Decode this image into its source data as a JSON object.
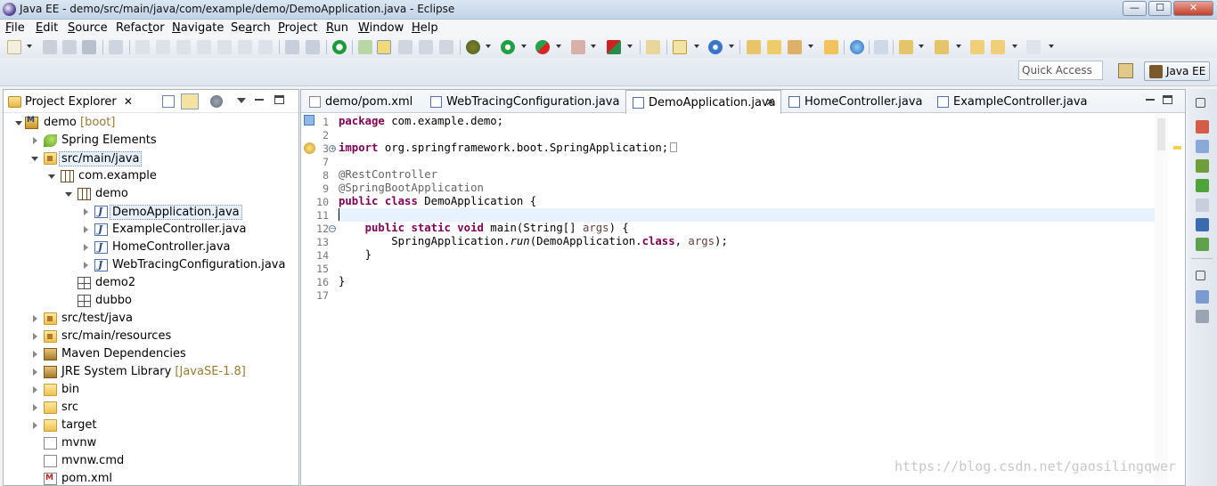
{
  "window": {
    "title": "Java EE - demo/src/main/java/com/example/demo/DemoApplication.java - Eclipse",
    "minimize": "—",
    "maximize": "☐",
    "close": "✕"
  },
  "menu": [
    {
      "u": "F",
      "rest": "ile"
    },
    {
      "u": "E",
      "rest": "dit"
    },
    {
      "u": "S",
      "rest": "ource"
    },
    {
      "u": "",
      "pre": "Refac",
      "uu": "t",
      "rest": "or"
    },
    {
      "u": "N",
      "rest": "avigate"
    },
    {
      "u": "",
      "pre": "Se",
      "uu": "a",
      "rest": "rch"
    },
    {
      "u": "P",
      "rest": "roject"
    },
    {
      "u": "R",
      "rest": "un"
    },
    {
      "u": "W",
      "rest": "indow"
    },
    {
      "u": "H",
      "rest": "elp"
    }
  ],
  "quick_access": {
    "placeholder": "Quick Access"
  },
  "perspective": {
    "label": "Java EE"
  },
  "explorer": {
    "title": "Project Explorer",
    "close": "✕",
    "tree": [
      {
        "label": "demo",
        "decor": "[boot]"
      },
      {
        "label": "Spring Elements"
      },
      {
        "label": "src/main/java"
      },
      {
        "label": "com.example"
      },
      {
        "label": "demo"
      },
      {
        "label": "DemoApplication.java"
      },
      {
        "label": "ExampleController.java"
      },
      {
        "label": "HomeController.java"
      },
      {
        "label": "WebTracingConfiguration.java"
      },
      {
        "label": "demo2"
      },
      {
        "label": "dubbo"
      },
      {
        "label": "src/test/java"
      },
      {
        "label": "src/main/resources"
      },
      {
        "label": "Maven Dependencies"
      },
      {
        "label": "JRE System Library",
        "decor": "[JavaSE-1.8]"
      },
      {
        "label": "bin"
      },
      {
        "label": "src"
      },
      {
        "label": "target"
      },
      {
        "label": "mvnw"
      },
      {
        "label": "mvnw.cmd"
      },
      {
        "label": "pom.xml"
      }
    ]
  },
  "editor": {
    "tabs": [
      {
        "label": "demo/pom.xml"
      },
      {
        "label": "WebTracingConfiguration.java"
      },
      {
        "label": "DemoApplication.java",
        "close": "✕"
      },
      {
        "label": "HomeController.java"
      },
      {
        "label": "ExampleController.java"
      }
    ],
    "line_numbers": [
      "1",
      "2",
      "3",
      "7",
      "8",
      "9",
      "10",
      "11",
      "12",
      "13",
      "14",
      "15",
      "16",
      "17"
    ],
    "code": {
      "l1_kw": "package",
      "l1_rest": " com.example.demo;",
      "l3_kw": "import",
      "l3_rest": " org.springframework.boot.SpringApplication;",
      "l8": "@RestController",
      "l9": "@SpringBootApplication",
      "l10_kw1": "public",
      "l10_kw2": "class",
      "l10_rest": " DemoApplication {",
      "l12_kw1": "public",
      "l12_kw2": "static",
      "l12_kw3": "void",
      "l12_rest": " main(String[] ",
      "l12_var": "args",
      "l12_end": ") {",
      "l13_a": "SpringApplication.",
      "l13_method": "run",
      "l13_b": "(DemoApplication.",
      "l13_kw": "class",
      "l13_c": ", ",
      "l13_var": "args",
      "l13_d": ");",
      "l14": "}",
      "l16": "}"
    }
  },
  "watermark": "https://blog.csdn.net/gaosilingqwer",
  "colors": {
    "keyword": "#7f0055",
    "annotation": "#646464",
    "current_line": "#e8f2fe"
  }
}
